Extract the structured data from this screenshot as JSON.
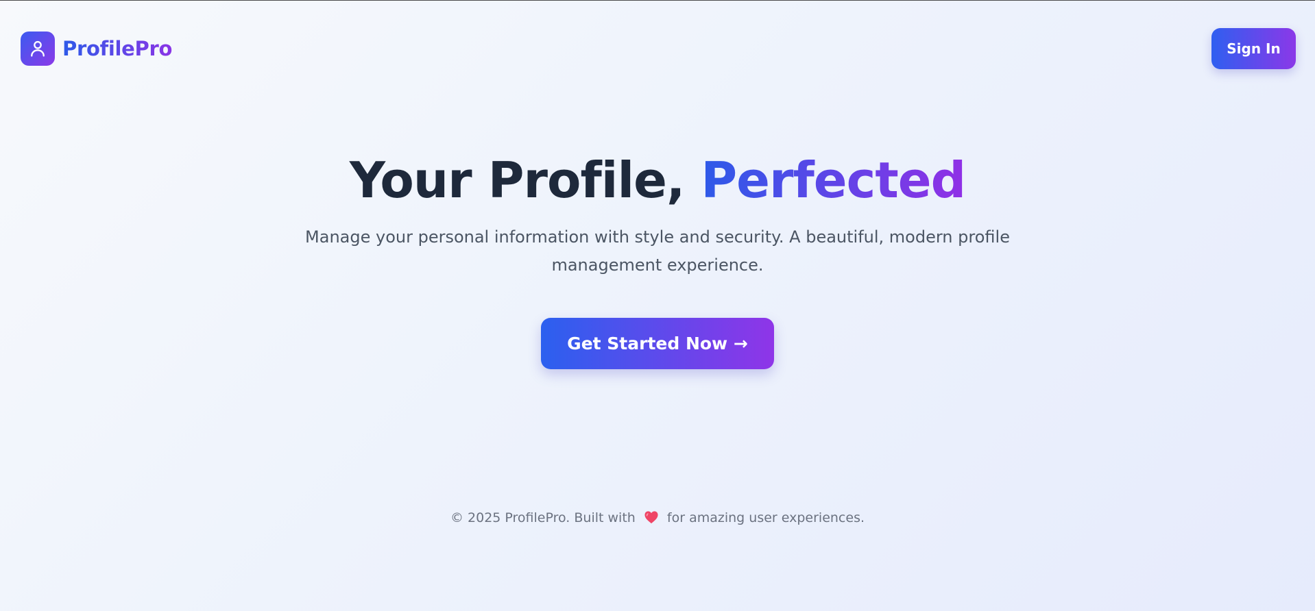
{
  "header": {
    "brand_name": "ProfilePro",
    "sign_in_label": "Sign In"
  },
  "hero": {
    "title_main": "Your Profile, ",
    "title_accent": "Perfected",
    "subtitle": "Manage your personal information with style and security. A beautiful, modern profile management experience.",
    "cta_label": "Get Started Now →"
  },
  "footer": {
    "text_before": "© 2025 ProfilePro. Built with",
    "text_after": "for amazing user experiences."
  },
  "icons": {
    "logo": "user-icon",
    "footer_heart": "heart-icon"
  },
  "colors": {
    "gradient_start": "#2d5ae8",
    "gradient_end": "#8b38e8",
    "heading": "#1e293b",
    "body_text": "#4b5563",
    "heart": "#ef4566"
  }
}
